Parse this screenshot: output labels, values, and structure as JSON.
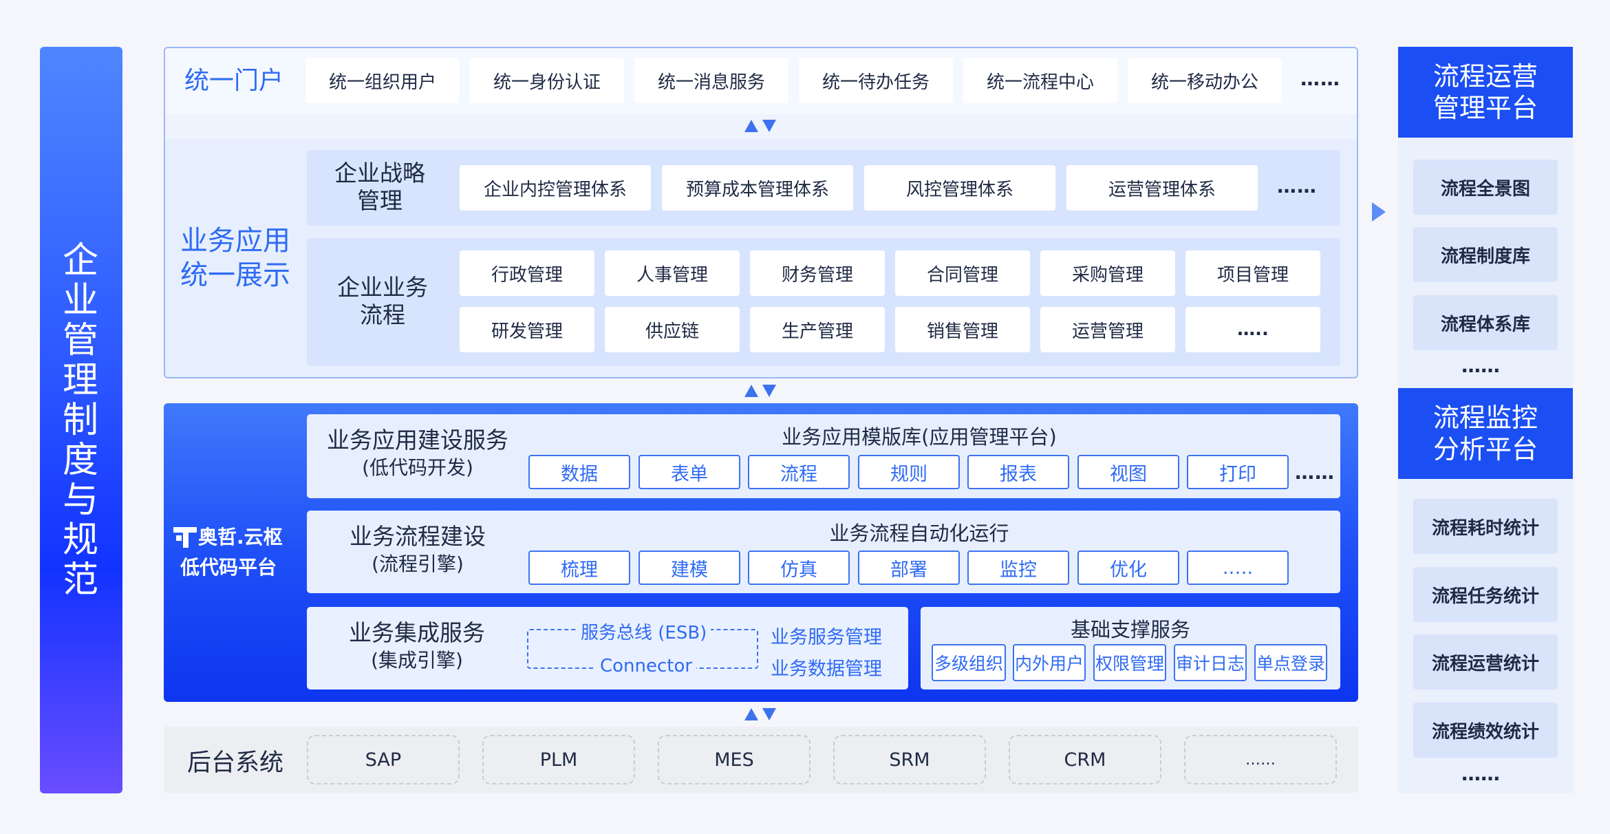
{
  "left_bar": {
    "title": "企业管理制度与规范"
  },
  "portal": {
    "title": "统一门户",
    "items": [
      "统一组织用户",
      "统一身份认证",
      "统一消息服务",
      "统一待办任务",
      "统一流程中心",
      "统一移动办公"
    ],
    "more": "……"
  },
  "app_display": {
    "title_line1": "业务应用",
    "title_line2": "统一展示",
    "strategy": {
      "label_line1": "企业战略",
      "label_line2": "管理",
      "items": [
        "企业内控管理体系",
        "预算成本管理体系",
        "风控管理体系",
        "运营管理体系"
      ],
      "more": "……"
    },
    "process": {
      "label_line1": "企业业务",
      "label_line2": "流程",
      "row1": [
        "行政管理",
        "人事管理",
        "财务管理",
        "合同管理",
        "采购管理",
        "项目管理"
      ],
      "row2": [
        "研发管理",
        "供应链",
        "生产管理",
        "销售管理",
        "运营管理",
        "….."
      ]
    }
  },
  "platform": {
    "brand": "奥哲.云枢",
    "name": "低代码平台",
    "app_build": {
      "label": "业务应用建设服务",
      "sub": "(低代码开发)",
      "head": "业务应用模版库(应用管理平台)",
      "items": [
        "数据",
        "表单",
        "流程",
        "规则",
        "报表",
        "视图",
        "打印"
      ],
      "more": "……"
    },
    "process_build": {
      "label": "业务流程建设",
      "sub": "(流程引擎)",
      "head": "业务流程自动化运行",
      "items": [
        "梳理",
        "建模",
        "仿真",
        "部署",
        "监控",
        "优化",
        ".…."
      ]
    },
    "integration": {
      "label": "业务集成服务",
      "sub": "(集成引擎)",
      "esb": "服务总线 (ESB)",
      "connector": "Connector",
      "service_mgmt": "业务服务管理",
      "data_mgmt": "业务数据管理"
    },
    "foundation": {
      "head": "基础支撑服务",
      "items": [
        "多级组织",
        "内外用户",
        "权限管理",
        "审计日志",
        "单点登录"
      ]
    }
  },
  "backend": {
    "title": "后台系统",
    "systems": [
      "SAP",
      "PLM",
      "MES",
      "SRM",
      "CRM",
      "……"
    ]
  },
  "right": {
    "ops_platform_line1": "流程运营",
    "ops_platform_line2": "管理平台",
    "ops_items": [
      "流程全景图",
      "流程制度库",
      "流程体系库"
    ],
    "ops_more": "……",
    "monitor_platform_line1": "流程监控",
    "monitor_platform_line2": "分析平台",
    "monitor_items": [
      "流程耗时统计",
      "流程任务统计",
      "流程运营统计",
      "流程绩效统计"
    ],
    "monitor_more": "……"
  },
  "colors": {
    "accent": "#2f6bf3",
    "platform_blue": "#1f50f7",
    "right_head": "#1b4ff3"
  }
}
